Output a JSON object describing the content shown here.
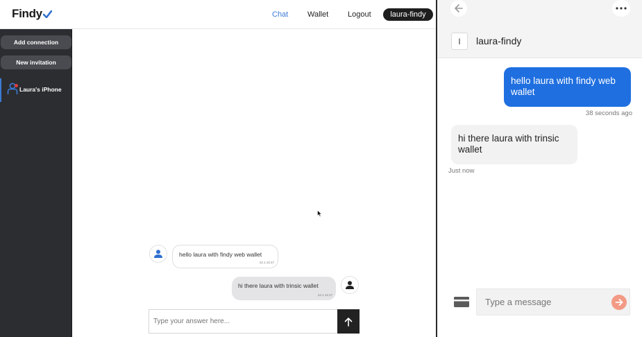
{
  "findy": {
    "logo_text": "Findy",
    "nav": {
      "chat": "Chat",
      "wallet": "Wallet",
      "logout": "Logout"
    },
    "user": "laura-findy",
    "sidebar": {
      "add_connection": "Add connection",
      "new_invitation": "New invitation",
      "connections": [
        {
          "label": "Laura's iPhone"
        }
      ]
    },
    "messages": [
      {
        "text": "hello laura with findy web wallet",
        "time": "12.1 14:17"
      },
      {
        "text": "hi there laura with trinsic wallet",
        "time": "12.1 14:17"
      }
    ],
    "answer_placeholder": "Type your answer here..."
  },
  "trinsic": {
    "contact_initial": "l",
    "contact_name": "laura-findy",
    "messages": [
      {
        "text": "hello laura with findy web wallet",
        "time": "38 seconds ago"
      },
      {
        "text": "hi there laura with trinsic wallet",
        "time": "Just now"
      }
    ],
    "message_placeholder": "Type a message"
  },
  "colors": {
    "accent_blue": "#1f6fe0",
    "nav_active": "#3b7bd6",
    "sidebar_bg": "#2c2d31",
    "send_coral": "#f39a85",
    "notification_red": "#e03b3b"
  }
}
